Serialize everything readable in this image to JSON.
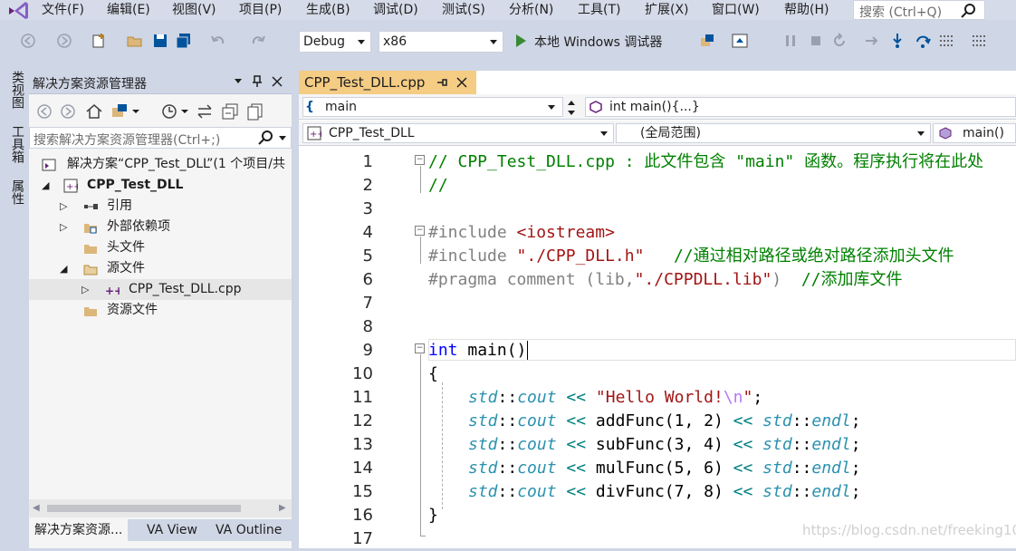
{
  "menu": [
    "文件(F)",
    "编辑(E)",
    "视图(V)",
    "项目(P)",
    "生成(B)",
    "调试(D)",
    "测试(S)",
    "分析(N)",
    "工具(T)",
    "扩展(X)",
    "窗口(W)",
    "帮助(H)"
  ],
  "search": {
    "placeholder": "搜索 (Ctrl+Q)"
  },
  "toolbar": {
    "config": "Debug",
    "platform": "x86",
    "run_label": "本地 Windows 调试器"
  },
  "left_strip": {
    "tabs": [
      "类视图",
      "工具箱",
      "属性"
    ]
  },
  "solution_explorer": {
    "title": "解决方案资源管理器",
    "search_placeholder": "搜索解决方案资源管理器(Ctrl+;)",
    "tree": [
      {
        "label": "解决方案“CPP_Test_DLL”(1 个项目/共",
        "bold": false
      },
      {
        "label": "CPP_Test_DLL",
        "bold": true
      },
      {
        "label": "引用"
      },
      {
        "label": "外部依赖项"
      },
      {
        "label": "头文件"
      },
      {
        "label": "源文件"
      },
      {
        "label": "CPP_Test_DLL.cpp"
      },
      {
        "label": "资源文件"
      }
    ],
    "bottom_tabs": [
      "解决方案资源...",
      "VA View",
      "VA Outline"
    ]
  },
  "editor": {
    "tab": "CPP_Test_DLL.cpp",
    "nav1_left": "main",
    "nav1_right": "int main(){...}",
    "nav2_project": "CPP_Test_DLL",
    "nav2_scope": "(全局范围)",
    "nav2_member": "main()",
    "line_numbers": [
      "1",
      "2",
      "3",
      "4",
      "5",
      "6",
      "7",
      "8",
      "9",
      "10",
      "11",
      "12",
      "13",
      "14",
      "15",
      "16",
      "17"
    ],
    "code": {
      "l1": "// CPP_Test_DLL.cpp : 此文件包含 \"main\" 函数。程序执行将在此处",
      "l2": "//",
      "l4_kw": "#include ",
      "l4_inc": "<iostream>",
      "l5_kw": "#include ",
      "l5_inc": "\"./CPP_DLL.h\"",
      "l5_com": "   //通过相对路径或绝对路径添加头文件",
      "l6_a": "#pragma comment ",
      "l6_b": "(lib,",
      "l6_str": "\"./CPPDLL.lib\"",
      "l6_c": ")  ",
      "l6_com": "//添加库文件",
      "l9_kw": "int",
      "l9_rest": " main()",
      "l10": "{",
      "std": "std",
      "cout": "cout",
      "endl": "endl",
      "l11_str": "\"Hello World!",
      "l11_esc": "\\n",
      "l11_end": "\"",
      "calls": [
        "addFunc(1, 2)",
        "subFunc(3, 4)",
        "mulFunc(5, 6)",
        "divFunc(7, 8)"
      ],
      "l16": "}"
    }
  },
  "watermark": "https://blog.csdn.net/freeking101"
}
